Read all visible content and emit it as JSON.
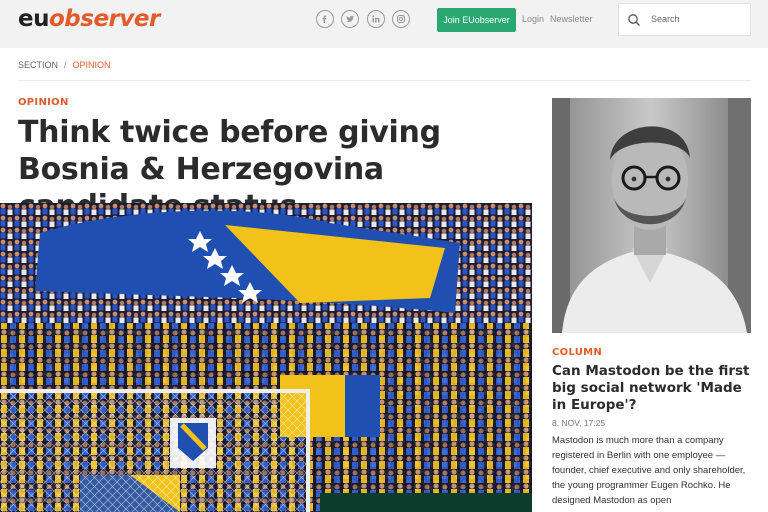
{
  "header": {
    "logo_eu": "eu",
    "logo_observer": "observer",
    "social": [
      "facebook-icon",
      "twitter-icon",
      "linkedin-icon",
      "instagram-icon"
    ],
    "join_label": "Join EUobserver",
    "login_label": "Login",
    "newsletter_label": "Newsletter",
    "search_placeholder": "Search"
  },
  "breadcrumb": {
    "section": "SECTION",
    "separator": "/",
    "current": "OPINION"
  },
  "article": {
    "kicker": "OPINION",
    "title": "Think twice before giving Bosnia & Herzegovina candidate status",
    "hero_image": "stadium-crowd-bosnian-flag-photo"
  },
  "sidebar_story": {
    "image": "portrait-photo-man-glasses",
    "kicker": "COLUMN",
    "title": "Can Mastodon be the first big social network 'Made in Europe'?",
    "date": "8. NOV, 17:25",
    "excerpt": "Mastodon is much more than a company registered in Berlin with one employee — founder, chief executive and only shareholder, the young programmer Eugen Rochko. He designed Mastodon as open"
  },
  "colors": {
    "brand_orange": "#e35b2a",
    "join_green": "#2aa872",
    "header_bg": "#f2f2f2",
    "flag_blue": "#1f4fb0",
    "flag_yellow": "#f2c21b"
  }
}
